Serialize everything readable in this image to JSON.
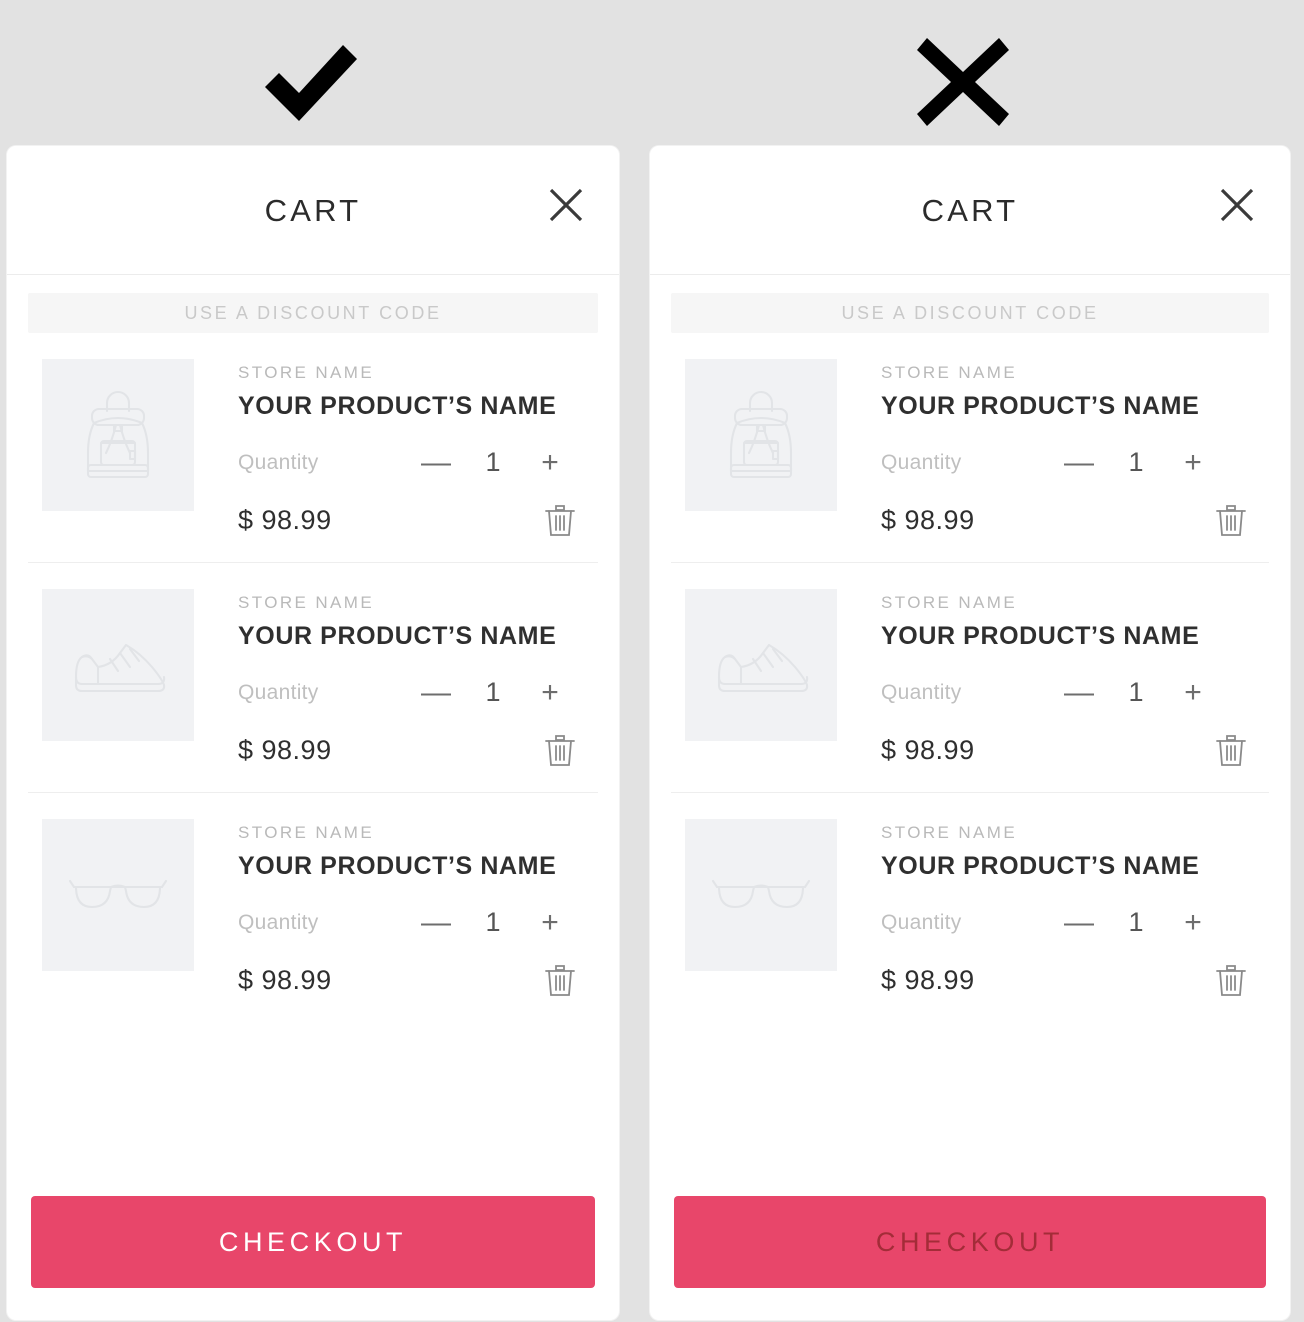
{
  "banner": {
    "good_mark": "checkmark-icon",
    "bad_mark": "cross-icon"
  },
  "colors": {
    "page_background": "#e2e2e2",
    "panel_background": "#ffffff",
    "checkout_pink": "#e8466a",
    "checkout_good_text": "#ffffff",
    "checkout_bad_text": "#a32c38",
    "thumb_background": "#f1f2f4",
    "discount_background": "#f6f6f6",
    "discount_text": "#c9c9c9",
    "divider": "#eeeeee"
  },
  "panels": [
    {
      "variant": "good",
      "verdict_icon": "checkmark-icon",
      "header": {
        "title": "CART",
        "close_icon": "close-x-icon"
      },
      "discount": {
        "label": "USE A DISCOUNT CODE"
      },
      "items": [
        {
          "thumb_icon": "backpack-icon",
          "store": "STORE NAME",
          "name": "YOUR PRODUCT’S NAME",
          "quantity_label": "Quantity",
          "decrement": "—",
          "quantity": "1",
          "increment": "+",
          "price": "$ 98.99",
          "remove_icon": "trash-icon"
        },
        {
          "thumb_icon": "sneaker-icon",
          "store": "STORE NAME",
          "name": "YOUR PRODUCT’S NAME",
          "quantity_label": "Quantity",
          "decrement": "—",
          "quantity": "1",
          "increment": "+",
          "price": "$ 98.99",
          "remove_icon": "trash-icon"
        },
        {
          "thumb_icon": "glasses-icon",
          "store": "STORE NAME",
          "name": "YOUR PRODUCT’S NAME",
          "quantity_label": "Quantity",
          "decrement": "—",
          "quantity": "1",
          "increment": "+",
          "price": "$ 98.99",
          "remove_icon": "trash-icon"
        }
      ],
      "checkout": {
        "label": "CHECKOUT"
      }
    },
    {
      "variant": "bad",
      "verdict_icon": "cross-icon",
      "header": {
        "title": "CART",
        "close_icon": "close-x-icon"
      },
      "discount": {
        "label": "USE A DISCOUNT CODE"
      },
      "items": [
        {
          "thumb_icon": "backpack-icon",
          "store": "STORE NAME",
          "name": "YOUR PRODUCT’S NAME",
          "quantity_label": "Quantity",
          "decrement": "—",
          "quantity": "1",
          "increment": "+",
          "price": "$ 98.99",
          "remove_icon": "trash-icon"
        },
        {
          "thumb_icon": "sneaker-icon",
          "store": "STORE NAME",
          "name": "YOUR PRODUCT’S NAME",
          "quantity_label": "Quantity",
          "decrement": "—",
          "quantity": "1",
          "increment": "+",
          "price": "$ 98.99",
          "remove_icon": "trash-icon"
        },
        {
          "thumb_icon": "glasses-icon",
          "store": "STORE NAME",
          "name": "YOUR PRODUCT’S NAME",
          "quantity_label": "Quantity",
          "decrement": "—",
          "quantity": "1",
          "increment": "+",
          "price": "$ 98.99",
          "remove_icon": "trash-icon"
        }
      ],
      "checkout": {
        "label": "CHECKOUT"
      }
    }
  ]
}
